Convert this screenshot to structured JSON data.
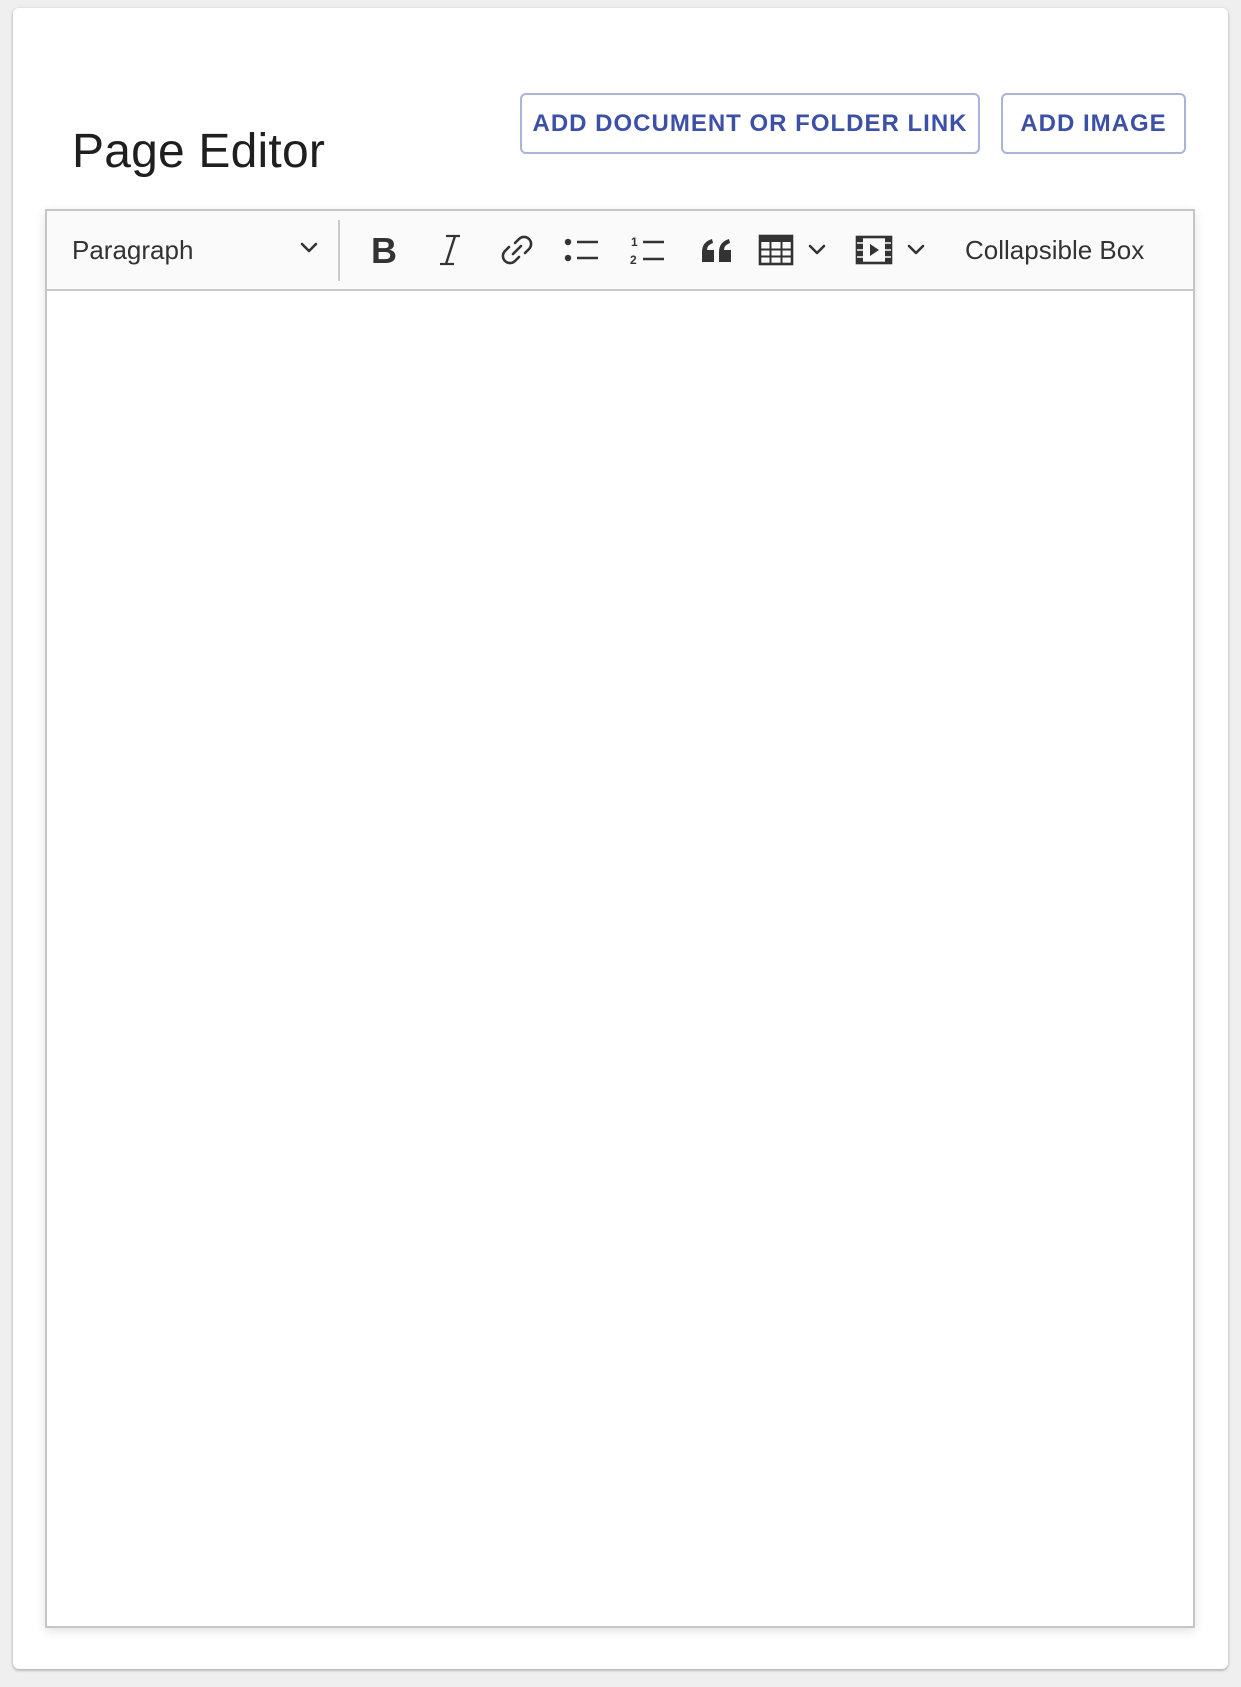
{
  "header": {
    "title": "Page Editor",
    "add_link_button": "ADD DOCUMENT OR FOLDER LINK",
    "add_image_button": "ADD IMAGE"
  },
  "toolbar": {
    "heading_select": {
      "selected": "Paragraph",
      "icon": "chevron-down-icon"
    },
    "buttons": [
      {
        "icon": "bold-icon"
      },
      {
        "icon": "italic-icon"
      },
      {
        "icon": "link-icon"
      },
      {
        "icon": "bulleted-list-icon"
      },
      {
        "icon": "numbered-list-icon"
      },
      {
        "icon": "block-quote-icon"
      },
      {
        "icon": "table-icon",
        "dropdown": true
      },
      {
        "icon": "media-embed-icon",
        "dropdown": true
      }
    ],
    "collapsible_box_label": "Collapsible Box"
  },
  "editor": {
    "content": ""
  },
  "colors": {
    "accent": "#3d50a8",
    "button_border": "#aab3d8",
    "toolbar_bg": "#fafafa",
    "page_bg": "#efefef"
  }
}
